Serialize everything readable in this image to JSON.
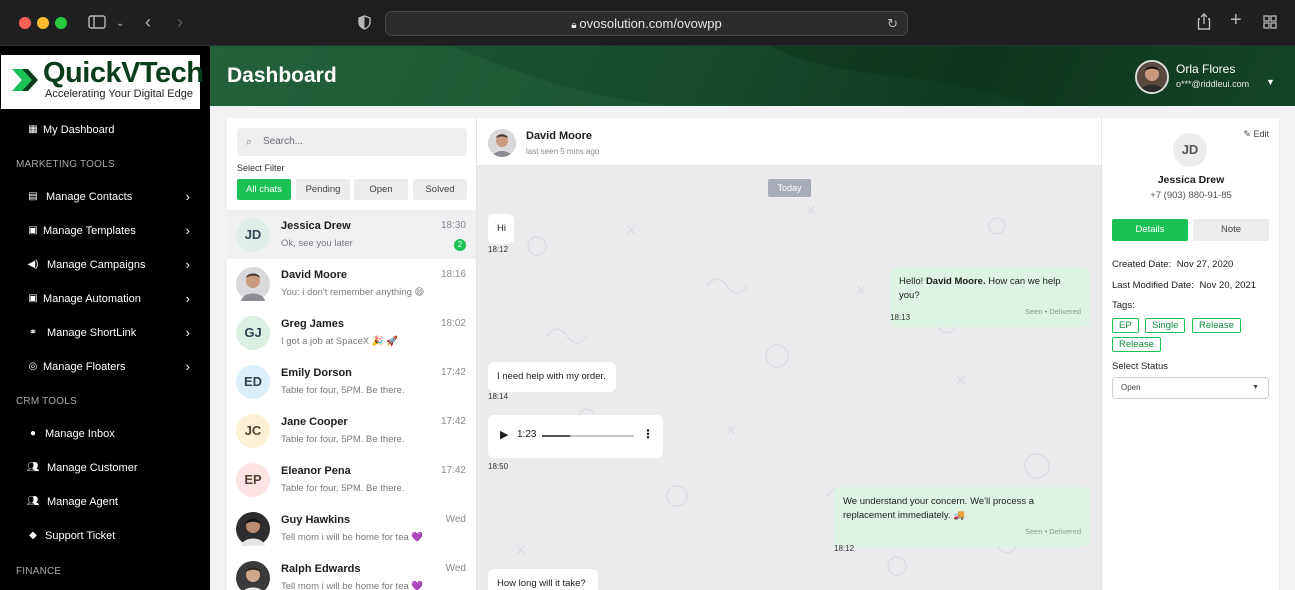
{
  "browser": {
    "url": "ovosolution.com/ovowpp",
    "lock_icon": "lock-icon"
  },
  "logo": {
    "title": "QuickVTech",
    "tagline": "Accelerating Your Digital Edge"
  },
  "sidebar": {
    "items": [
      {
        "label": "My Dashboard",
        "icon": "grid-icon"
      },
      {
        "label": "Manage Contacts",
        "icon": "contact-card-icon"
      },
      {
        "label": "Manage Templates",
        "icon": "template-icon"
      },
      {
        "label": "Manage Campaigns",
        "icon": "megaphone-icon"
      },
      {
        "label": "Manage Automation",
        "icon": "automation-icon"
      },
      {
        "label": "Manage ShortLink",
        "icon": "link-icon"
      },
      {
        "label": "Manage Floaters",
        "icon": "whatsapp-icon"
      },
      {
        "label": "Manage Inbox",
        "icon": "chat-bubble-icon"
      },
      {
        "label": "Manage Customer",
        "icon": "users-icon"
      },
      {
        "label": "Manage Agent",
        "icon": "agents-icon"
      },
      {
        "label": "Support Ticket",
        "icon": "ticket-icon"
      }
    ],
    "sections": {
      "marketing": "MARKETING TOOLS",
      "crm": "CRM TOOLS",
      "finance": "FINANCE"
    }
  },
  "header": {
    "title": "Dashboard",
    "user_name": "Orla Flores",
    "user_email": "o***@riddleui.com"
  },
  "chat_list": {
    "search_placeholder": "Search...",
    "filter_label": "Select Filter",
    "filters": [
      "All chats",
      "Pending",
      "Open",
      "Solved"
    ],
    "chats": [
      {
        "initials": "JD",
        "name": "Jessica Drew",
        "message": "Ok, see you later",
        "time": "18:30",
        "unread": "2"
      },
      {
        "initials": "",
        "name": "David Moore",
        "message": "You: i don't remember anything 😄",
        "time": "18:16",
        "unread": ""
      },
      {
        "initials": "GJ",
        "name": "Greg James",
        "message": "I got a job at SpaceX 🎉 🚀",
        "time": "18:02",
        "unread": ""
      },
      {
        "initials": "ED",
        "name": "Emily Dorson",
        "message": "Table for four, 5PM. Be there.",
        "time": "17:42",
        "unread": ""
      },
      {
        "initials": "JC",
        "name": "Jane Cooper",
        "message": "Table for four, 5PM. Be there.",
        "time": "17:42",
        "unread": ""
      },
      {
        "initials": "EP",
        "name": "Eleanor Pena",
        "message": "Table for four, 5PM. Be there.",
        "time": "17:42",
        "unread": ""
      },
      {
        "initials": "",
        "name": "Guy Hawkins",
        "message": "Tell mom i will be home for tea 💜",
        "time": "Wed",
        "unread": ""
      },
      {
        "initials": "",
        "name": "Ralph Edwards",
        "message": "Tell mom i will be home for tea 💜",
        "time": "Wed",
        "unread": ""
      }
    ]
  },
  "conversation": {
    "contact_name": "David Moore",
    "last_seen": "last seen 5 mins ago",
    "date_divider": "Today",
    "messages": [
      {
        "direction": "in",
        "text": "Hi",
        "time": "18:12"
      },
      {
        "direction": "out",
        "text_before": "Hello! ",
        "bold": "David Moore.",
        "text_after": " How can we help you?",
        "meta": "Seen • Delivered",
        "time": "18:13"
      },
      {
        "direction": "in",
        "text": "I need help with my order.",
        "time": "18:14"
      },
      {
        "direction": "in",
        "type": "audio",
        "duration": "1:23",
        "progress": 0.3,
        "time": "18:50"
      },
      {
        "direction": "out",
        "text": "We understand your concern. We'll process a replacement immediately. 🚚",
        "meta": "Seen • Delivered",
        "time": "18:12"
      },
      {
        "direction": "in",
        "text": "How long will it take?",
        "time": ""
      }
    ]
  },
  "details": {
    "edit_label": "Edit",
    "initials": "JD",
    "name": "Jessica Drew",
    "phone": "+7 (903) 880-91-85",
    "tabs": [
      "Details",
      "Note"
    ],
    "created_label": "Created Date:",
    "created_value": "Nov 27, 2020",
    "modified_label": "Last Modified Date:",
    "modified_value": "Nov 20, 2021",
    "tags_label": "Tags:",
    "tags": [
      "EP",
      "Single",
      "Release",
      "Release"
    ],
    "status_label": "Select Status",
    "status_value": "Open"
  },
  "colors": {
    "accent": "#1ac154",
    "header_green": "#174a2d",
    "outgoing_bubble": "#dff3e4"
  }
}
